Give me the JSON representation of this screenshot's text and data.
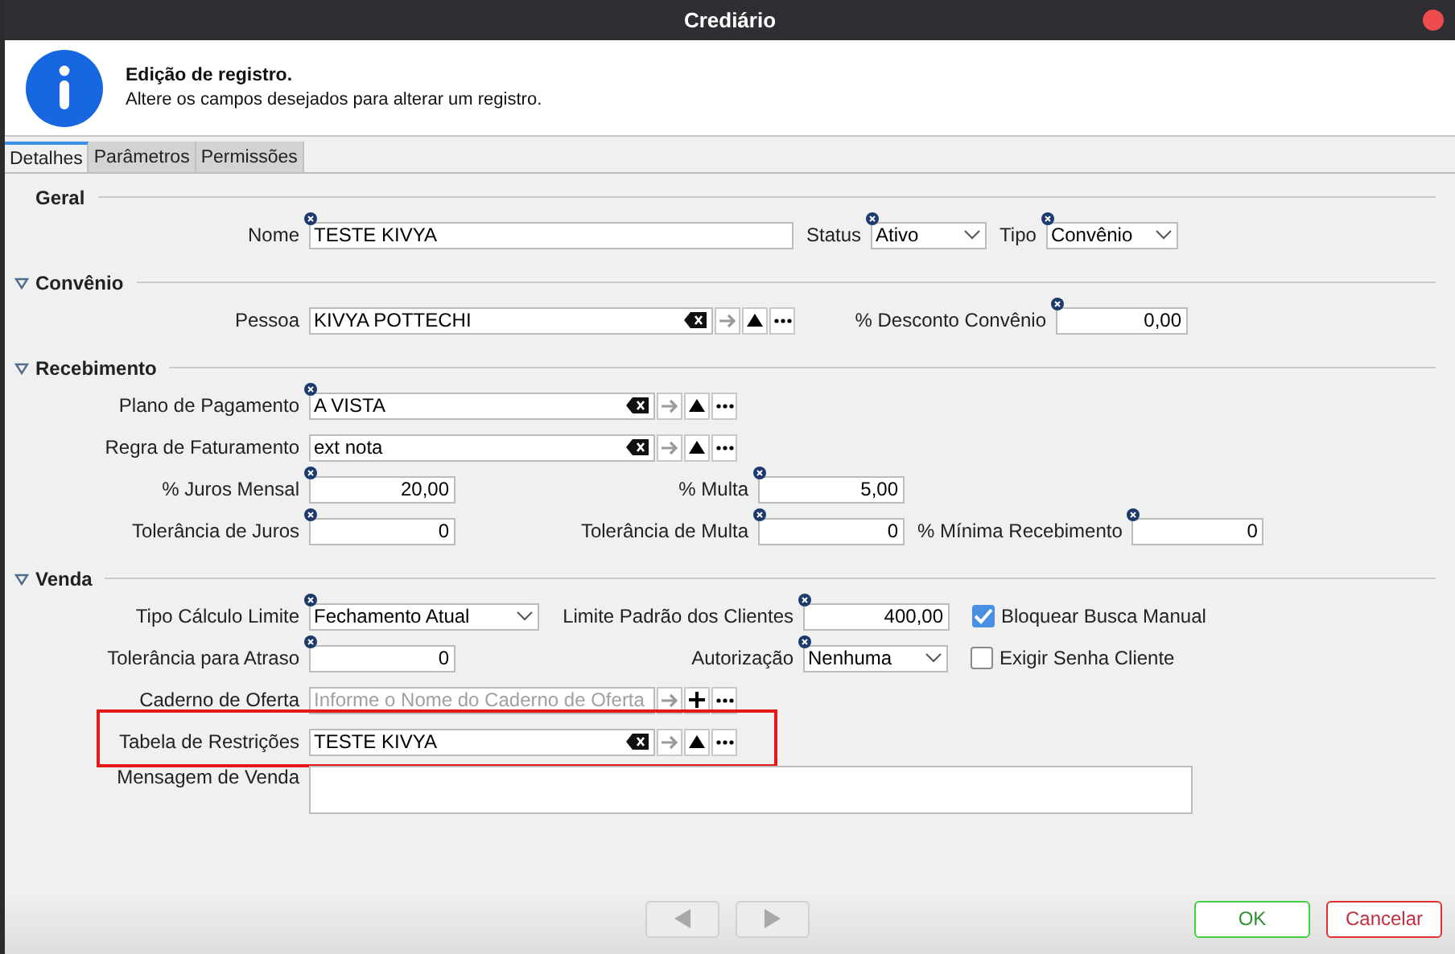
{
  "window": {
    "title": "Crediário"
  },
  "header": {
    "title": "Edição de registro.",
    "subtitle": "Altere os campos desejados para alterar um registro."
  },
  "tabs": [
    {
      "label": "Detalhes",
      "selected": true
    },
    {
      "label": "Parâmetros",
      "selected": false
    },
    {
      "label": "Permissões",
      "selected": false
    }
  ],
  "sections": [
    {
      "title": "Geral",
      "rows": [
        {
          "highlighted": false,
          "fields": [
            {
              "kind": "text",
              "label": "Nome",
              "value": "TESTE KIVYA",
              "required": true,
              "numeric": false
            },
            {
              "kind": "select",
              "label": "Status",
              "value": "Ativo",
              "required": true
            },
            {
              "kind": "select",
              "label": "Tipo",
              "value": "Convênio",
              "required": true
            }
          ]
        }
      ]
    },
    {
      "title": "Convênio",
      "expanded": true,
      "rows": [
        {
          "highlighted": false,
          "fields": [
            {
              "kind": "lookup",
              "label": "Pessoa",
              "value": "KIVYA POTTECHI",
              "add_button": false,
              "required": false
            },
            {
              "kind": "text",
              "label": "% Desconto Convênio",
              "value": "0,00",
              "required": true,
              "numeric": true
            }
          ]
        }
      ]
    },
    {
      "title": "Recebimento",
      "expanded": true,
      "rows": [
        {
          "highlighted": false,
          "fields": [
            {
              "kind": "lookup",
              "label": "Plano de Pagamento",
              "value": "A VISTA",
              "add_button": false,
              "required": true
            }
          ]
        },
        {
          "highlighted": false,
          "fields": [
            {
              "kind": "lookup",
              "label": "Regra de Faturamento",
              "value": "ext nota",
              "add_button": false,
              "required": false
            }
          ]
        },
        {
          "highlighted": false,
          "fields": [
            {
              "kind": "text",
              "label": "% Juros Mensal",
              "value": "20,00",
              "required": true,
              "numeric": true
            },
            {
              "kind": "text",
              "label": "% Multa",
              "value": "5,00",
              "required": true,
              "numeric": true
            }
          ]
        },
        {
          "highlighted": false,
          "fields": [
            {
              "kind": "text",
              "label": "Tolerância de Juros",
              "value": "0",
              "required": true,
              "numeric": true
            },
            {
              "kind": "text",
              "label": "Tolerância de Multa",
              "value": "0",
              "required": true,
              "numeric": true
            },
            {
              "kind": "text",
              "label": "% Mínima Recebimento",
              "value": "0",
              "required": true,
              "numeric": true
            }
          ]
        }
      ]
    },
    {
      "title": "Venda",
      "expanded": true,
      "rows": [
        {
          "highlighted": false,
          "fields": [
            {
              "kind": "select",
              "label": "Tipo Cálculo Limite",
              "value": "Fechamento Atual",
              "required": true
            },
            {
              "kind": "text",
              "label": "Limite Padrão dos Clientes",
              "value": "400,00",
              "required": true,
              "numeric": true
            },
            {
              "kind": "checkbox",
              "label": "Bloquear Busca Manual",
              "checked": true
            }
          ]
        },
        {
          "highlighted": false,
          "fields": [
            {
              "kind": "text",
              "label": "Tolerância para Atraso",
              "value": "0",
              "required": true,
              "numeric": true
            },
            {
              "kind": "select",
              "label": "Autorização",
              "value": "Nenhuma",
              "required": true
            },
            {
              "kind": "checkbox",
              "label": "Exigir Senha Cliente",
              "checked": false
            }
          ]
        },
        {
          "highlighted": false,
          "fields": [
            {
              "kind": "lookup",
              "label": "Caderno de Oferta",
              "placeholder": "Informe o Nome do Caderno de Oferta",
              "add_button": true,
              "required": false
            }
          ]
        },
        {
          "highlighted": true,
          "fields": [
            {
              "kind": "lookup",
              "label": "Tabela de Restrições",
              "value": "TESTE KIVYA",
              "add_button": false,
              "required": false
            }
          ]
        },
        {
          "highlighted": false,
          "fields": [
            {
              "kind": "textarea",
              "label": "Mensagem de Venda",
              "required": false
            }
          ]
        }
      ]
    }
  ],
  "footer": {
    "ok": "OK",
    "cancel": "Cancelar"
  }
}
